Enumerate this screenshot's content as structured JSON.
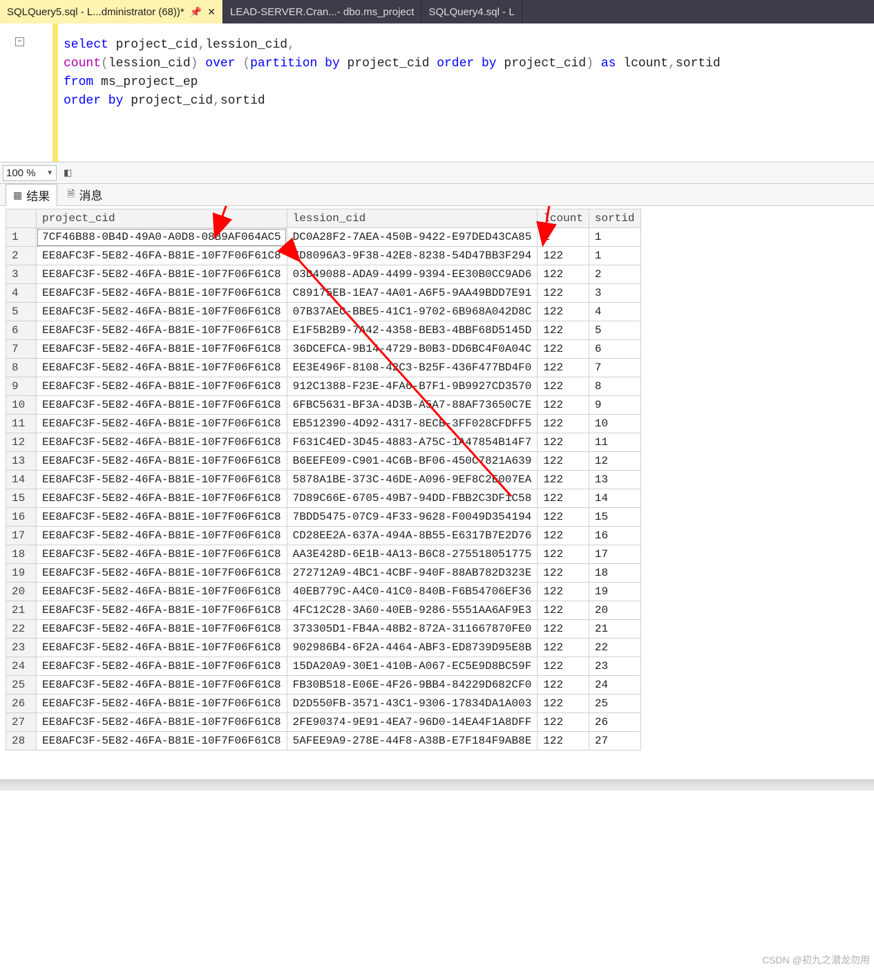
{
  "tabs": [
    {
      "label": "SQLQuery5.sql - L...dministrator (68))*",
      "active": true,
      "pinned": true,
      "close": true
    },
    {
      "label": "LEAD-SERVER.Cran...- dbo.ms_project",
      "active": false
    },
    {
      "label": "SQLQuery4.sql - L",
      "active": false
    }
  ],
  "zoom": {
    "value": "100 %"
  },
  "result_tabs": {
    "results": "结果",
    "messages": "消息"
  },
  "sql": {
    "select": "select",
    "count": "count",
    "over": "over",
    "partition_by": "partition by",
    "order_by": "order by",
    "as": "as",
    "from": "from",
    "project_cid": " project_cid",
    "lession_cid": "lession_cid",
    "lession_cid2": "lession_cid",
    "project_cid2": " project_cid ",
    "project_cid3": " project_cid",
    "lcount": " lcount",
    "sortid": "sortid",
    "ms_project_ep": " ms_project_ep",
    "project_cid4": " project_cid",
    "sortid2": "sortid",
    "comma": ",",
    "lp": "(",
    "rp": ")",
    "sp": " "
  },
  "columns": [
    "project_cid",
    "lession_cid",
    "lcount",
    "sortid"
  ],
  "rows": [
    {
      "n": 1,
      "project_cid": "7CF46B88-0B4D-49A0-A0D8-08B9AF064AC5",
      "lession_cid": "DC0A28F2-7AEA-450B-9422-E97DED43CA85",
      "lcount": "1",
      "sortid": "1"
    },
    {
      "n": 2,
      "project_cid": "EE8AFC3F-5E82-46FA-B81E-10F7F06F61C8",
      "lession_cid": "7D8096A3-9F38-42E8-8238-54D47BB3F294",
      "lcount": "122",
      "sortid": "1"
    },
    {
      "n": 3,
      "project_cid": "EE8AFC3F-5E82-46FA-B81E-10F7F06F61C8",
      "lession_cid": "03D49088-ADA9-4499-9394-EE30B0CC9AD6",
      "lcount": "122",
      "sortid": "2"
    },
    {
      "n": 4,
      "project_cid": "EE8AFC3F-5E82-46FA-B81E-10F7F06F61C8",
      "lession_cid": "C89175EB-1EA7-4A01-A6F5-9AA49BDD7E91",
      "lcount": "122",
      "sortid": "3"
    },
    {
      "n": 5,
      "project_cid": "EE8AFC3F-5E82-46FA-B81E-10F7F06F61C8",
      "lession_cid": "07B37AEC-BBE5-41C1-9702-6B968A042D8C",
      "lcount": "122",
      "sortid": "4"
    },
    {
      "n": 6,
      "project_cid": "EE8AFC3F-5E82-46FA-B81E-10F7F06F61C8",
      "lession_cid": "E1F5B2B9-7A42-4358-BEB3-4BBF68D5145D",
      "lcount": "122",
      "sortid": "5"
    },
    {
      "n": 7,
      "project_cid": "EE8AFC3F-5E82-46FA-B81E-10F7F06F61C8",
      "lession_cid": "36DCEFCA-9B14-4729-B0B3-DD6BC4F0A04C",
      "lcount": "122",
      "sortid": "6"
    },
    {
      "n": 8,
      "project_cid": "EE8AFC3F-5E82-46FA-B81E-10F7F06F61C8",
      "lession_cid": "EE3E496F-8108-42C3-B25F-436F477BD4F0",
      "lcount": "122",
      "sortid": "7"
    },
    {
      "n": 9,
      "project_cid": "EE8AFC3F-5E82-46FA-B81E-10F7F06F61C8",
      "lession_cid": "912C1388-F23E-4FA6-B7F1-9B9927CD3570",
      "lcount": "122",
      "sortid": "8"
    },
    {
      "n": 10,
      "project_cid": "EE8AFC3F-5E82-46FA-B81E-10F7F06F61C8",
      "lession_cid": "6FBC5631-BF3A-4D3B-A5A7-88AF73650C7E",
      "lcount": "122",
      "sortid": "9"
    },
    {
      "n": 11,
      "project_cid": "EE8AFC3F-5E82-46FA-B81E-10F7F06F61C8",
      "lession_cid": "EB512390-4D92-4317-8ECB-3FF028CFDFF5",
      "lcount": "122",
      "sortid": "10"
    },
    {
      "n": 12,
      "project_cid": "EE8AFC3F-5E82-46FA-B81E-10F7F06F61C8",
      "lession_cid": "F631C4ED-3D45-4883-A75C-1A47854B14F7",
      "lcount": "122",
      "sortid": "11"
    },
    {
      "n": 13,
      "project_cid": "EE8AFC3F-5E82-46FA-B81E-10F7F06F61C8",
      "lession_cid": "B6EEFE09-C901-4C6B-BF06-450C7821A639",
      "lcount": "122",
      "sortid": "12"
    },
    {
      "n": 14,
      "project_cid": "EE8AFC3F-5E82-46FA-B81E-10F7F06F61C8",
      "lession_cid": "5878A1BE-373C-46DE-A096-9EF8C2E007EA",
      "lcount": "122",
      "sortid": "13"
    },
    {
      "n": 15,
      "project_cid": "EE8AFC3F-5E82-46FA-B81E-10F7F06F61C8",
      "lession_cid": "7D89C66E-6705-49B7-94DD-FBB2C3DF1C58",
      "lcount": "122",
      "sortid": "14"
    },
    {
      "n": 16,
      "project_cid": "EE8AFC3F-5E82-46FA-B81E-10F7F06F61C8",
      "lession_cid": "7BDD5475-07C9-4F33-9628-F0049D354194",
      "lcount": "122",
      "sortid": "15"
    },
    {
      "n": 17,
      "project_cid": "EE8AFC3F-5E82-46FA-B81E-10F7F06F61C8",
      "lession_cid": "CD28EE2A-637A-494A-8B55-E6317B7E2D76",
      "lcount": "122",
      "sortid": "16"
    },
    {
      "n": 18,
      "project_cid": "EE8AFC3F-5E82-46FA-B81E-10F7F06F61C8",
      "lession_cid": "AA3E428D-6E1B-4A13-B6C8-275518051775",
      "lcount": "122",
      "sortid": "17"
    },
    {
      "n": 19,
      "project_cid": "EE8AFC3F-5E82-46FA-B81E-10F7F06F61C8",
      "lession_cid": "272712A9-4BC1-4CBF-940F-88AB782D323E",
      "lcount": "122",
      "sortid": "18"
    },
    {
      "n": 20,
      "project_cid": "EE8AFC3F-5E82-46FA-B81E-10F7F06F61C8",
      "lession_cid": "40EB779C-A4C0-41C0-840B-F6B54706EF36",
      "lcount": "122",
      "sortid": "19"
    },
    {
      "n": 21,
      "project_cid": "EE8AFC3F-5E82-46FA-B81E-10F7F06F61C8",
      "lession_cid": "4FC12C28-3A60-40EB-9286-5551AA6AF9E3",
      "lcount": "122",
      "sortid": "20"
    },
    {
      "n": 22,
      "project_cid": "EE8AFC3F-5E82-46FA-B81E-10F7F06F61C8",
      "lession_cid": "373305D1-FB4A-48B2-872A-311667870FE0",
      "lcount": "122",
      "sortid": "21"
    },
    {
      "n": 23,
      "project_cid": "EE8AFC3F-5E82-46FA-B81E-10F7F06F61C8",
      "lession_cid": "902986B4-6F2A-4464-ABF3-ED8739D95E8B",
      "lcount": "122",
      "sortid": "22"
    },
    {
      "n": 24,
      "project_cid": "EE8AFC3F-5E82-46FA-B81E-10F7F06F61C8",
      "lession_cid": "15DA20A9-30E1-410B-A067-EC5E9D8BC59F",
      "lcount": "122",
      "sortid": "23"
    },
    {
      "n": 25,
      "project_cid": "EE8AFC3F-5E82-46FA-B81E-10F7F06F61C8",
      "lession_cid": "FB30B518-E06E-4F26-9BB4-84229D682CF0",
      "lcount": "122",
      "sortid": "24"
    },
    {
      "n": 26,
      "project_cid": "EE8AFC3F-5E82-46FA-B81E-10F7F06F61C8",
      "lession_cid": "D2D550FB-3571-43C1-9306-17834DA1A003",
      "lcount": "122",
      "sortid": "25"
    },
    {
      "n": 27,
      "project_cid": "EE8AFC3F-5E82-46FA-B81E-10F7F06F61C8",
      "lession_cid": "2FE90374-9E91-4EA7-96D0-14EA4F1A8DFF",
      "lcount": "122",
      "sortid": "26"
    },
    {
      "n": 28,
      "project_cid": "EE8AFC3F-5E82-46FA-B81E-10F7F06F61C8",
      "lession_cid": "5AFEE9A9-278E-44F8-A38B-E7F184F9AB8E",
      "lcount": "122",
      "sortid": "27"
    }
  ],
  "watermark": "CSDN @初九之潜龙勿用"
}
